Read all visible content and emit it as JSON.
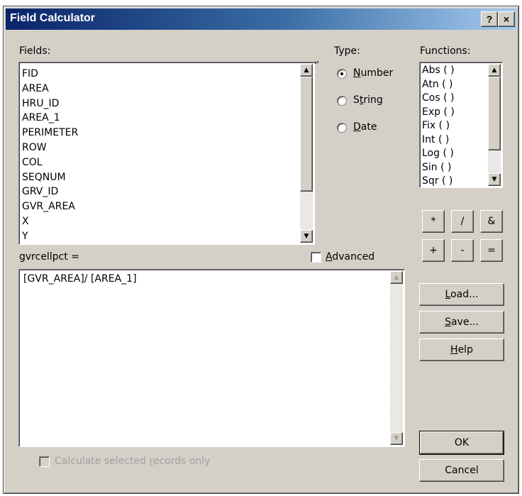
{
  "window": {
    "title": "Field Calculator",
    "help_glyph": "?",
    "close_glyph": "×"
  },
  "fields": {
    "label": "Fields:",
    "items": [
      "FID",
      "AREA",
      "HRU_ID",
      "AREA_1",
      "PERIMETER",
      "ROW",
      "COL",
      "SEQNUM",
      "GRV_ID",
      "GVR_AREA",
      "X",
      "Y"
    ]
  },
  "type": {
    "label": "Type:",
    "options": [
      {
        "label": "Number",
        "selected": true
      },
      {
        "label": "String",
        "selected": false
      },
      {
        "label": "Date",
        "selected": false
      }
    ]
  },
  "functions": {
    "label": "Functions:",
    "items": [
      "Abs ( )",
      "Atn ( )",
      "Cos ( )",
      "Exp ( )",
      "Fix ( )",
      "Int ( )",
      "Log ( )",
      "Sin ( )",
      "Sqr ( )"
    ]
  },
  "operators": [
    "*",
    "/",
    "&",
    "+",
    "-",
    "="
  ],
  "expression": {
    "label": "gvrcellpct =",
    "value": "[GVR_AREA]/ [AREA_1]"
  },
  "advanced": {
    "label": "Advanced",
    "checked": false
  },
  "buttons": {
    "load": "Load...",
    "save": "Save...",
    "help": "Help",
    "ok": "OK",
    "cancel": "Cancel"
  },
  "calc_selected": {
    "label": "Calculate selected records only",
    "checked": false,
    "disabled": true
  },
  "icons": {
    "scroll_up": "scroll-up-arrow-icon",
    "scroll_down": "scroll-down-arrow-icon",
    "sort": "sort-icon"
  }
}
